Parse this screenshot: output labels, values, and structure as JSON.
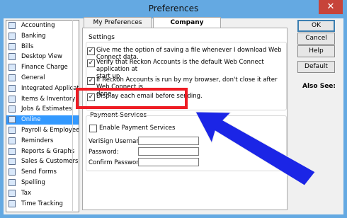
{
  "window": {
    "title": "Preferences",
    "close_glyph": "✕"
  },
  "categories": [
    {
      "label": "Accounting",
      "icon": "accounting-icon"
    },
    {
      "label": "Banking",
      "icon": "banking-icon"
    },
    {
      "label": "Bills",
      "icon": "bills-icon"
    },
    {
      "label": "Desktop View",
      "icon": "desktop-view-icon"
    },
    {
      "label": "Finance Charge",
      "icon": "finance-charge-icon"
    },
    {
      "label": "General",
      "icon": "general-icon"
    },
    {
      "label": "Integrated Applications",
      "icon": "integrated-applications-icon"
    },
    {
      "label": "Items & Inventory",
      "icon": "items-inventory-icon"
    },
    {
      "label": "Jobs & Estimates",
      "icon": "jobs-estimates-icon"
    },
    {
      "label": "Online",
      "icon": "online-icon",
      "selected": true
    },
    {
      "label": "Payroll & Employees",
      "icon": "payroll-employees-icon"
    },
    {
      "label": "Reminders",
      "icon": "reminders-icon"
    },
    {
      "label": "Reports & Graphs",
      "icon": "reports-graphs-icon"
    },
    {
      "label": "Sales & Customers",
      "icon": "sales-customers-icon"
    },
    {
      "label": "Send Forms",
      "icon": "send-forms-icon"
    },
    {
      "label": "Spelling",
      "icon": "spelling-icon"
    },
    {
      "label": "Tax",
      "icon": "tax-icon"
    },
    {
      "label": "Time Tracking",
      "icon": "time-tracking-icon"
    }
  ],
  "tabs": {
    "my": "My Preferences",
    "company": "Company Preferences"
  },
  "settings": {
    "title": "Settings",
    "checks": [
      {
        "lines": [
          "Give me the option of saving a file whenever I download Web Connect data."
        ],
        "checked": true
      },
      {
        "lines": [
          "Verify that Reckon Accounts is the default Web Connect application at",
          "start up."
        ],
        "checked": true
      },
      {
        "lines": [
          "If Reckon Accounts is run by my browser, don't close it after Web Connect is",
          "done."
        ],
        "checked": true
      },
      {
        "lines": [
          "Display each email before sending."
        ],
        "checked": true
      }
    ]
  },
  "payment": {
    "title": "Payment Services",
    "enable_label": "Enable Payment Services",
    "enable_checked": false,
    "verisign_label": "VeriSign Username:",
    "password_label": "Password:",
    "confirm_label": "Confirm Password:"
  },
  "buttons": {
    "ok": "OK",
    "cancel": "Cancel",
    "help": "Help",
    "default": "Default"
  },
  "also_see": "Also See:",
  "annotation_colors": {
    "highlight_box": "#ee1c24",
    "arrow": "#1b25e6"
  }
}
